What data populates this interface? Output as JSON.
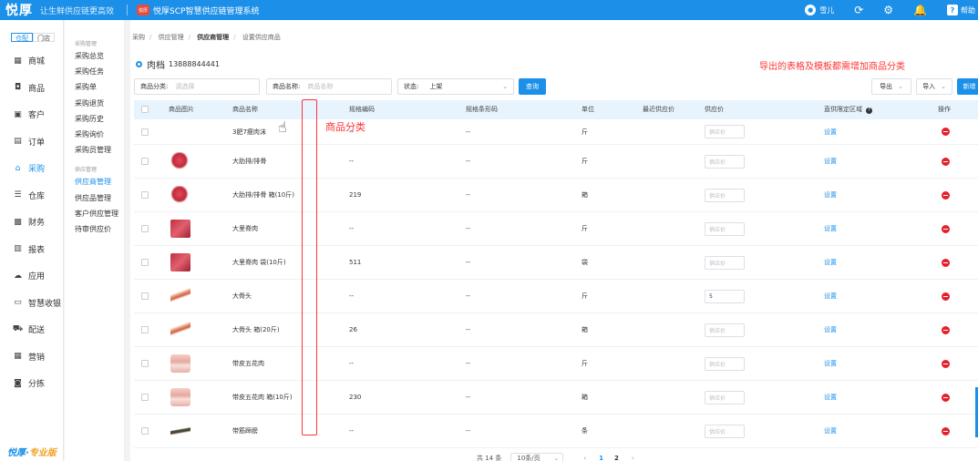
{
  "topbar": {
    "logo": "悦厚",
    "slogan": "让生鲜供应链更高效",
    "brand_badge": "悦厚",
    "system_name": "悦厚SCP智慧供应链管理系统",
    "user": "雪儿",
    "help": "帮助"
  },
  "sidebar": {
    "tabs": [
      "仓配",
      "门店"
    ],
    "items": [
      {
        "label": "商城",
        "icon": "store-icon"
      },
      {
        "label": "商品",
        "icon": "bag-icon"
      },
      {
        "label": "客户",
        "icon": "customer-icon"
      },
      {
        "label": "订单",
        "icon": "order-icon"
      },
      {
        "label": "采购",
        "icon": "purchase-icon"
      },
      {
        "label": "仓库",
        "icon": "warehouse-icon"
      },
      {
        "label": "财务",
        "icon": "finance-icon"
      },
      {
        "label": "报表",
        "icon": "report-icon"
      },
      {
        "label": "应用",
        "icon": "cloud-icon"
      },
      {
        "label": "智慧收银",
        "icon": "cashier-icon"
      },
      {
        "label": "配送",
        "icon": "truck-icon"
      },
      {
        "label": "营销",
        "icon": "marketing-icon"
      },
      {
        "label": "分拣",
        "icon": "sorting-icon"
      }
    ],
    "footer_brand": "悦厚·",
    "footer_edition": "专业版"
  },
  "submenu": {
    "group1": "采购管理",
    "group1_items": [
      "采购总览",
      "采购任务",
      "采购单",
      "采购退货",
      "采购历史",
      "采购询价",
      "采购员管理"
    ],
    "group2": "供应管理",
    "group2_items": [
      "供应商管理",
      "供应品管理",
      "客户供应管理",
      "待审供应价"
    ]
  },
  "breadcrumb": [
    "采购",
    "供应管理",
    "供应商管理",
    "设置供应商品"
  ],
  "supplier": {
    "name": "肉档",
    "phone": "13888844441"
  },
  "annotations": {
    "top": "导出的表格及模板都需增加商品分类",
    "column": "商品分类"
  },
  "filters": {
    "category_label": "商品分类:",
    "category_placeholder": "请选择",
    "name_label": "商品名称:",
    "name_placeholder": "商品名称",
    "status_label": "状态:",
    "status_value": "上架",
    "query_button": "查询",
    "export_button": "导出",
    "import_button": "导入",
    "new_button": "新增"
  },
  "table": {
    "headers": {
      "image": "商品图片",
      "name": "商品名称",
      "spec_code": "规格编码",
      "barcode": "规格条形码",
      "unit": "单位",
      "recent_price": "最近供应价",
      "supply_price": "供应价",
      "region": "直供限定区域",
      "action": "操作"
    },
    "price_placeholder": "供应价",
    "set_label": "设置",
    "rows": [
      {
        "name": "3肥7瘦肉沫",
        "code": "--",
        "barcode": "--",
        "unit": "斤",
        "price": "",
        "img": "none"
      },
      {
        "name": "大肋排/排骨",
        "code": "--",
        "barcode": "--",
        "unit": "斤",
        "price": "",
        "img": "meat"
      },
      {
        "name": "大肋排/排骨 箱(10斤)",
        "code": "219",
        "barcode": "--",
        "unit": "箱",
        "price": "",
        "img": "meat"
      },
      {
        "name": "大里脊肉",
        "code": "--",
        "barcode": "--",
        "unit": "斤",
        "price": "",
        "img": "block"
      },
      {
        "name": "大里脊肉 袋(10斤)",
        "code": "511",
        "barcode": "--",
        "unit": "袋",
        "price": "",
        "img": "block"
      },
      {
        "name": "大骨头",
        "code": "--",
        "barcode": "--",
        "unit": "斤",
        "price": "5",
        "img": "bone"
      },
      {
        "name": "大骨头 箱(20斤)",
        "code": "26",
        "barcode": "--",
        "unit": "箱",
        "price": "",
        "img": "bone"
      },
      {
        "name": "带皮五花肉",
        "code": "--",
        "barcode": "--",
        "unit": "斤",
        "price": "",
        "img": "belly"
      },
      {
        "name": "带皮五花肉 箱(10斤)",
        "code": "230",
        "barcode": "--",
        "unit": "箱",
        "price": "",
        "img": "belly"
      },
      {
        "name": "带筋蹄膀",
        "code": "--",
        "barcode": "--",
        "unit": "条",
        "price": "",
        "img": "trotter"
      }
    ]
  },
  "pagination": {
    "total": "共 14 条",
    "page_size": "10条/页",
    "pages": [
      "1",
      "2"
    ],
    "current": "1"
  }
}
